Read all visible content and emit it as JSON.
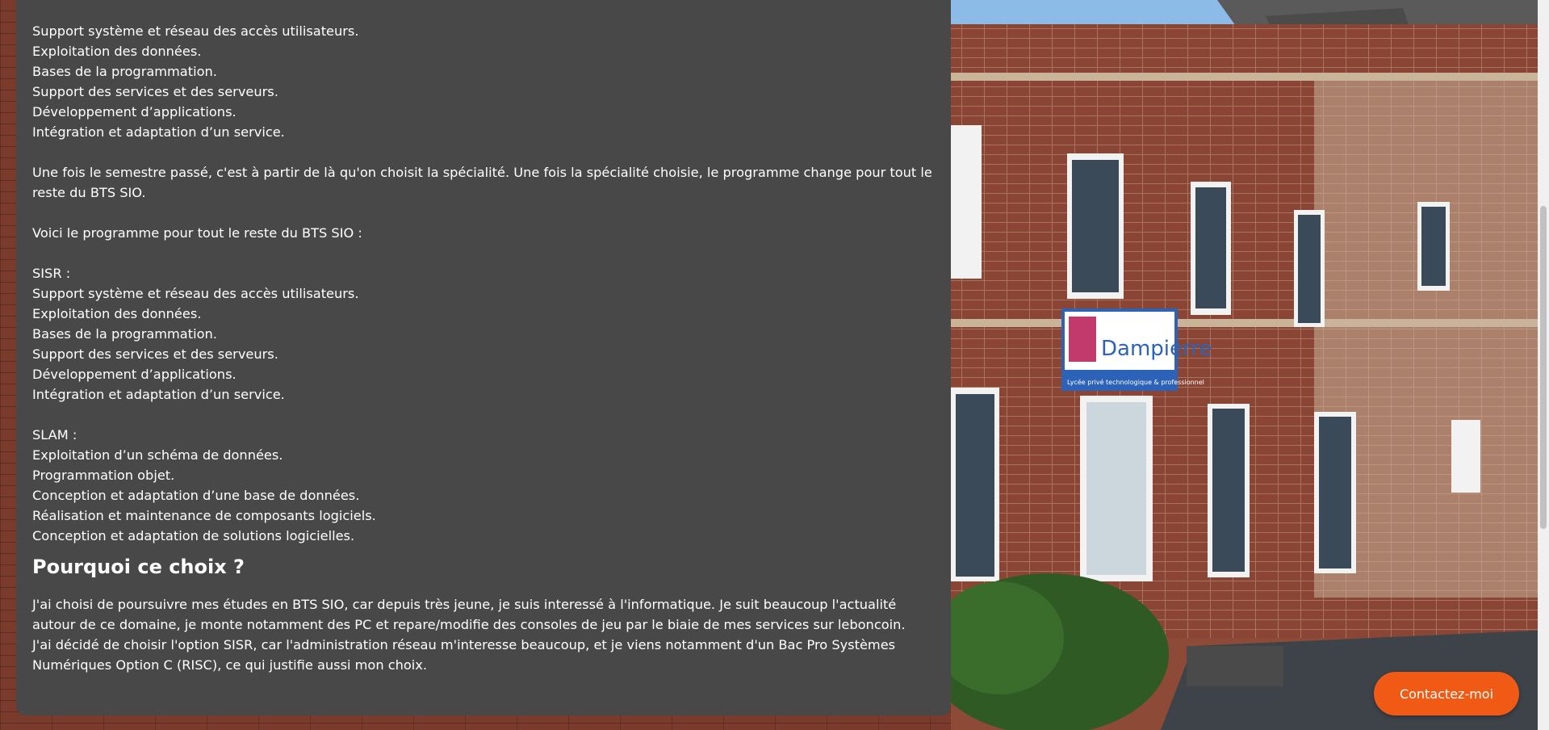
{
  "sections": {
    "first_semester": [
      "Support système et réseau des accès utilisateurs.",
      "Exploitation des données.",
      "Bases de la programmation.",
      "Support des services et des serveurs.",
      "Développement d’applications.",
      "Intégration et adaptation d’un service."
    ],
    "specialty_intro": "Une fois le semestre passé, c'est à partir de là qu'on choisit la spécialité. Une fois la spécialité choisie, le programme change pour tout le reste du BTS SIO.",
    "program_intro": "Voici le programme pour tout le reste du BTS SIO :",
    "sisr": {
      "title": "SISR :",
      "items": [
        "Support système et réseau des accès utilisateurs.",
        "Exploitation des données.",
        "Bases de la programmation.",
        "Support des services et des serveurs.",
        "Développement d’applications.",
        "Intégration et adaptation d’un service."
      ]
    },
    "slam": {
      "title": "SLAM :",
      "items": [
        "Exploitation d’un schéma de données.",
        "Programmation objet.",
        "Conception et adaptation d’une base de données.",
        "Réalisation et maintenance de composants logiciels.",
        "Conception et adaptation de solutions logicielles."
      ]
    },
    "why": {
      "heading": "Pourquoi ce choix ?",
      "paragraph1": "J'ai choisi de poursuivre mes études en BTS SIO, car depuis très jeune, je suis interessé à l'informatique. Je suit beaucoup l'actualité autour de ce domaine, je monte notamment des PC et repare/modifie des consoles de jeu par le biaie de mes services sur leboncoin.",
      "paragraph2": "J'ai décidé de choisir l'option SISR, car l'administration réseau m'interesse beaucoup, et je viens notamment d'un Bac Pro Systèmes Numériques Option C (RISC), ce qui justifie aussi mon choix."
    }
  },
  "photo": {
    "sign_text": "Dampierre",
    "sign_subtext": "Lycée privé technologique & professionnel"
  },
  "contact_button": {
    "label": "Contactez-moi"
  },
  "colors": {
    "card_bg": "#484848",
    "accent": "#f05a14"
  }
}
